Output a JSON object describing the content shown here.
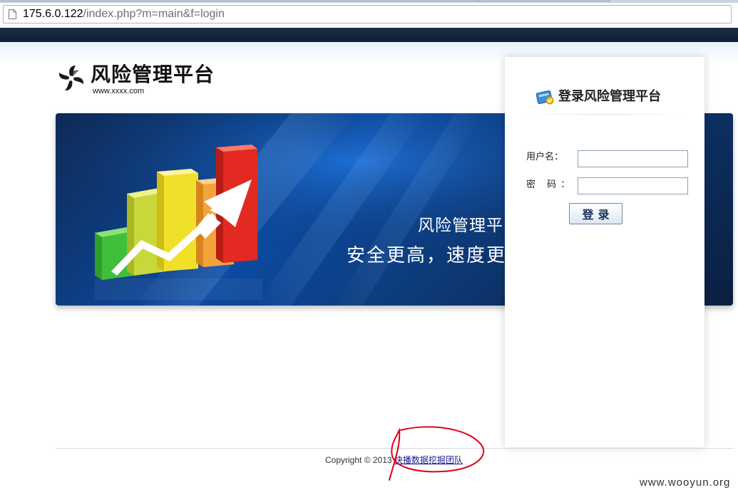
{
  "browser": {
    "url_host": "175.6.0.122",
    "url_path": "/index.php?m=main&f=login",
    "page_icon": "page-icon"
  },
  "header": {
    "logo_icon": "pinwheel-logo-icon",
    "title": "风险管理平台",
    "site_url": "www.xxxx.com"
  },
  "banner": {
    "line1": "风险管理平台",
    "line2": "安全更高，速度更快",
    "chart_icon": "growth-bar-chart-icon",
    "bars_colors": [
      "#3fbf3a",
      "#c8d83a",
      "#f0e02a",
      "#f4a23a",
      "#e32a22"
    ],
    "arrow_color": "#ffffff"
  },
  "login": {
    "title": "登录风险管理平台",
    "title_icon": "login-card-icon",
    "username_label": "用户名：",
    "password_label": "密  码：",
    "username_value": "",
    "password_value": "",
    "submit_label": "登录"
  },
  "footer": {
    "copyright_prefix": "Copyright © 2013 ",
    "team_link": "快播数据挖掘团队",
    "annotation_color": "#e0001a"
  },
  "watermark": "www.wooyun.org",
  "colors": {
    "top_band": "#13243f",
    "banner_blue": "#0c4aa0",
    "input_border": "#8aa0b2"
  }
}
